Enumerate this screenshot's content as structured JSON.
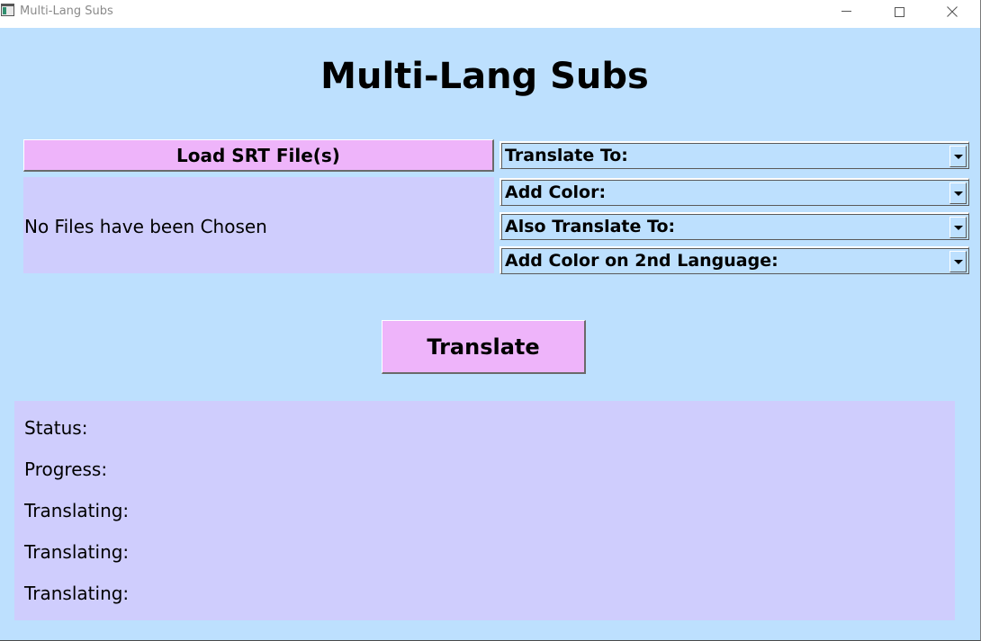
{
  "window": {
    "title": "Multi-Lang Subs"
  },
  "icons": {
    "app": "app-window-icon",
    "minimize": "minimize-icon",
    "maximize": "maximize-icon",
    "close": "close-icon",
    "dropdown_arrow": "chevron-down-icon"
  },
  "heading": "Multi-Lang Subs",
  "load_button_label": "Load SRT File(s)",
  "files_status": "No Files have been Chosen",
  "dropdowns": [
    {
      "label": "Translate To:"
    },
    {
      "label": "Add Color:"
    },
    {
      "label": "Also Translate To:"
    },
    {
      "label": "Add Color on 2nd Language:"
    }
  ],
  "translate_button_label": "Translate",
  "status_panel": {
    "lines": [
      "Status:",
      "Progress:",
      "Translating:",
      "Translating:",
      "Translating:"
    ]
  },
  "colors": {
    "background": "#bde0fe",
    "button": "#eeb4fa",
    "panel": "#cfcdfd"
  }
}
